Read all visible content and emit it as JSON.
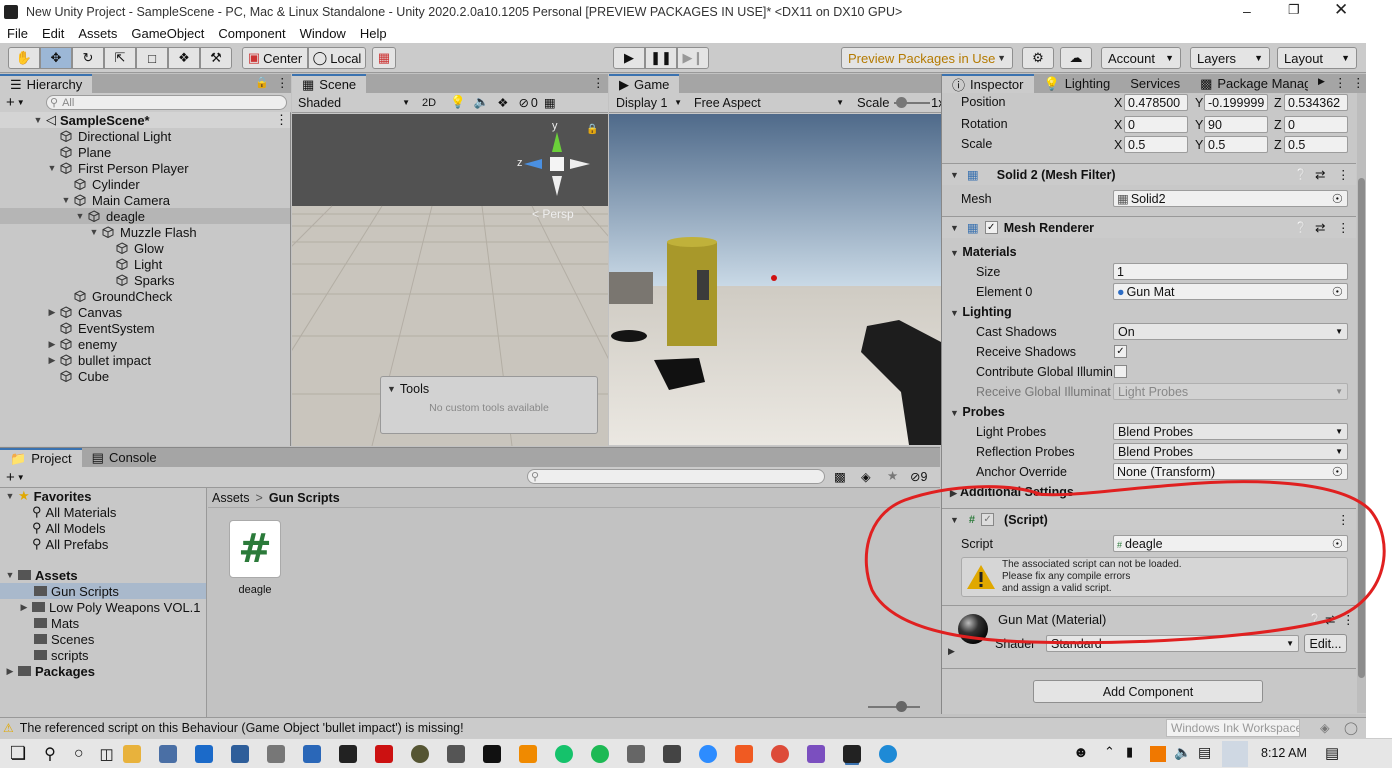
{
  "window": {
    "title": "New Unity Project - SampleScene - PC, Mac & Linux Standalone - Unity 2020.2.0a10.1205 Personal [PREVIEW PACKAGES IN USE]* <DX11 on DX10 GPU>"
  },
  "menu": [
    "File",
    "Edit",
    "Assets",
    "GameObject",
    "Component",
    "Window",
    "Help"
  ],
  "toolbar": {
    "pivot": "Center",
    "space": "Local",
    "preview_packages": "Preview Packages in Use",
    "account": "Account",
    "layers": "Layers",
    "layout": "Layout"
  },
  "hierarchy": {
    "tab": "Hierarchy",
    "search_placeholder": "All",
    "scene": "SampleScene*",
    "items": {
      "directional_light": "Directional Light",
      "plane": "Plane",
      "first_person_player": "First Person Player",
      "cylinder": "Cylinder",
      "main_camera": "Main Camera",
      "deagle": "deagle",
      "muzzle_flash": "Muzzle Flash",
      "glow": "Glow",
      "light": "Light",
      "sparks": "Sparks",
      "ground_check": "GroundCheck",
      "canvas": "Canvas",
      "event_system": "EventSystem",
      "enemy": "enemy",
      "bullet_impact": "bullet impact",
      "cube": "Cube"
    }
  },
  "scene_view": {
    "tab": "Scene",
    "shading": "Shaded",
    "mode_2d": "2D",
    "hidden_count": "0",
    "persp": "Persp",
    "gizmo_y": "y",
    "gizmo_z": "z",
    "tools_title": "Tools",
    "tools_empty": "No custom tools available"
  },
  "game_view": {
    "tab": "Game",
    "display": "Display 1",
    "aspect": "Free Aspect",
    "scale_label": "Scale",
    "scale_value": "1x"
  },
  "inspector": {
    "tabs": [
      "Inspector",
      "Lighting",
      "Services",
      "Package Manag"
    ],
    "transform": {
      "position_label": "Position",
      "rotation_label": "Rotation",
      "scale_label": "Scale",
      "x": "X",
      "y": "Y",
      "z": "Z",
      "position": [
        "0.478500",
        "-0.199999",
        "0.534362"
      ],
      "rotation": [
        "0",
        "90",
        "0"
      ],
      "scale": [
        "0.5",
        "0.5",
        "0.5"
      ]
    },
    "mesh_filter": {
      "title": "Solid 2 (Mesh Filter)",
      "mesh_label": "Mesh",
      "mesh_value": "Solid2"
    },
    "mesh_renderer": {
      "title": "Mesh Renderer",
      "materials": "Materials",
      "size_label": "Size",
      "size_value": "1",
      "element0_label": "Element 0",
      "element0_value": "Gun Mat",
      "lighting": "Lighting",
      "cast_shadows_label": "Cast Shadows",
      "cast_shadows_value": "On",
      "receive_shadows_label": "Receive Shadows",
      "contribute_gi_label": "Contribute Global Illumin",
      "receive_gi_label": "Receive Global Illuminat",
      "receive_gi_value": "Light Probes",
      "probes": "Probes",
      "light_probes_label": "Light Probes",
      "light_probes_value": "Blend Probes",
      "reflection_probes_label": "Reflection Probes",
      "reflection_probes_value": "Blend Probes",
      "anchor_override_label": "Anchor Override",
      "anchor_override_value": "None (Transform)",
      "additional_settings": "Additional Settings"
    },
    "script": {
      "title": "(Script)",
      "script_label": "Script",
      "script_value": "deagle",
      "warning_line1": "The associated script can not be loaded.",
      "warning_line2": "Please fix any compile errors",
      "warning_line3": "and assign a valid script."
    },
    "material": {
      "title": "Gun Mat (Material)",
      "shader_label": "Shader",
      "shader_value": "Standard",
      "edit": "Edit..."
    },
    "add_component": "Add Component"
  },
  "project": {
    "tab_project": "Project",
    "tab_console": "Console",
    "hidden_count": "9",
    "favorites": "Favorites",
    "fav_items": [
      "All Materials",
      "All Models",
      "All Prefabs"
    ],
    "assets": "Assets",
    "asset_folders": [
      "Gun Scripts",
      "Low Poly Weapons VOL.1",
      "Mats",
      "Scenes",
      "scripts"
    ],
    "packages": "Packages",
    "breadcrumb_root": "Assets",
    "breadcrumb_sep": ">",
    "breadcrumb_current": "Gun Scripts",
    "file_name": "deagle"
  },
  "status": {
    "message": "The referenced script on this Behaviour (Game Object 'bullet impact') is missing!"
  },
  "taskbar": {
    "time": "8:12 AM",
    "ink": "Windows Ink Workspace"
  },
  "colors": {
    "annotation": "#e02020",
    "accent": "#3a72b0",
    "warning": "#e0a800"
  }
}
